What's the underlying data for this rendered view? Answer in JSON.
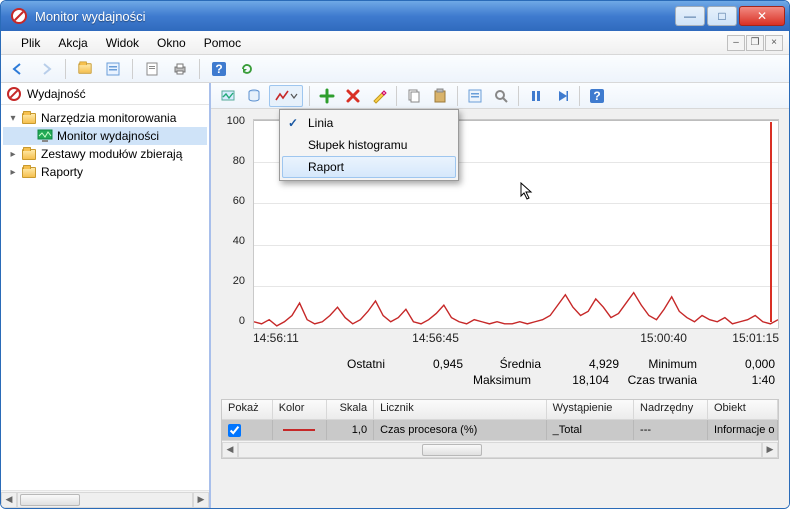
{
  "window": {
    "title": "Monitor wydajności"
  },
  "menubar": {
    "items": [
      "Plik",
      "Akcja",
      "Widok",
      "Okno",
      "Pomoc"
    ]
  },
  "tree": {
    "header": "Wydajność",
    "items": [
      {
        "label": "Narzędzia monitorowania",
        "indent": 0,
        "twisty": "▾",
        "icon": "folder"
      },
      {
        "label": "Monitor wydajności",
        "indent": 1,
        "twisty": "",
        "icon": "monitor",
        "selected": true
      },
      {
        "label": "Zestawy modułów zbierają",
        "indent": 0,
        "twisty": "▸",
        "icon": "folder"
      },
      {
        "label": "Raporty",
        "indent": 0,
        "twisty": "▸",
        "icon": "folder"
      }
    ]
  },
  "dropdown": {
    "items": [
      {
        "label": "Linia",
        "checked": true
      },
      {
        "label": "Słupek histogramu",
        "checked": false
      },
      {
        "label": "Raport",
        "checked": false,
        "hover": true
      }
    ]
  },
  "chart_data": {
    "type": "line",
    "yticks": [
      0,
      20,
      40,
      60,
      80,
      100
    ],
    "ylim": [
      0,
      100
    ],
    "x_labels": [
      "14:56:11",
      "14:56:45",
      "15:00:40",
      "15:01:15"
    ],
    "series": [
      {
        "name": "Czas procesora (%)",
        "color": "#c62828",
        "values": [
          3,
          2,
          4,
          1,
          3,
          6,
          12,
          4,
          2,
          3,
          6,
          10,
          5,
          2,
          4,
          8,
          13,
          6,
          3,
          5,
          9,
          3,
          2,
          4,
          7,
          11,
          5,
          3,
          2,
          4,
          3,
          2,
          3,
          2,
          2,
          3,
          2,
          3,
          4,
          6,
          11,
          16,
          10,
          6,
          8,
          14,
          10,
          5,
          7,
          12,
          17,
          11,
          6,
          4,
          9,
          15,
          8,
          5,
          3,
          6,
          4,
          3,
          5,
          2,
          3,
          4,
          6,
          3,
          2,
          4
        ]
      }
    ],
    "position_marker_x": 0.985
  },
  "stats": {
    "labels": {
      "last": "Ostatni",
      "avg": "Średnia",
      "min": "Minimum",
      "max": "Maksimum",
      "dur": "Czas trwania"
    },
    "values": {
      "last": "0,945",
      "avg": "4,929",
      "min": "0,000",
      "max": "18,104",
      "dur": "1:40"
    }
  },
  "table": {
    "headers": {
      "show": "Pokaż",
      "color": "Kolor",
      "scale": "Skala",
      "counter": "Licznik",
      "instance": "Wystąpienie",
      "parent": "Nadrzędny",
      "object": "Obiekt"
    },
    "rows": [
      {
        "show": true,
        "color": "#c62828",
        "scale": "1,0",
        "counter": "Czas procesora (%)",
        "instance": "_Total",
        "parent": "---",
        "object": "Informacje o"
      }
    ]
  }
}
